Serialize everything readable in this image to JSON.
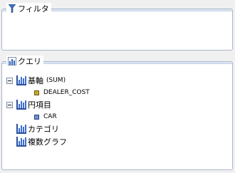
{
  "filter_section": {
    "title": "フィルタ",
    "icon": "funnel-icon"
  },
  "query_section": {
    "title": "クエリ",
    "icon": "bar-chart-icon",
    "tree": {
      "measure_group": {
        "label": "基軸",
        "suffix": "(SUM)",
        "field": "DEALER_COST"
      },
      "pie_items": {
        "label": "円項目",
        "field": "CAR"
      },
      "category": {
        "label": "カテゴリ"
      },
      "multiple_graphs": {
        "label": "複数グラフ"
      }
    }
  },
  "colors": {
    "border": "#a8b6cc",
    "measure_field": "#c8a820",
    "dimension_field": "#6f8fd0"
  }
}
